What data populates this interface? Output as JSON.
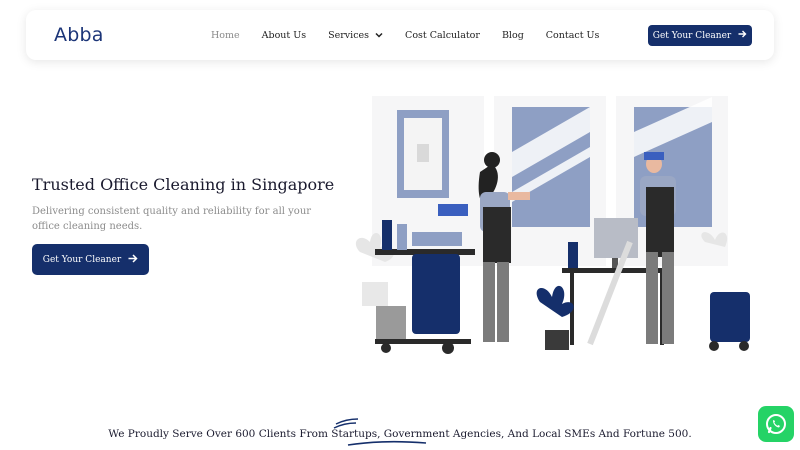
{
  "brand": {
    "name": "Abba",
    "color": "#1c3578"
  },
  "nav": {
    "items": [
      {
        "label": "Home",
        "active": true
      },
      {
        "label": "About Us"
      },
      {
        "label": "Services",
        "dropdown": true
      },
      {
        "label": "Cost Calculator"
      },
      {
        "label": "Blog"
      },
      {
        "label": "Contact Us"
      }
    ],
    "cta_label": "Get Your Cleaner"
  },
  "hero": {
    "title": "Trusted Office Cleaning in Singapore",
    "subtitle": "Delivering consistent quality and reliability for all your office cleaning needs.",
    "cta_label": "Get Your Cleaner",
    "accent_color": "#152f6b"
  },
  "tagline": {
    "text": "We Proudly Serve Over 600 Clients From Startups, Government Agencies, And Local SMEs And Fortune 500."
  },
  "icons": {
    "arrow": "arrow-right-icon",
    "whatsapp": "whatsapp-icon",
    "chevron": "chevron-down-icon"
  },
  "colors": {
    "primary": "#152f6b",
    "illustration_blue": "#8e9fc4",
    "whatsapp": "#25d366"
  }
}
